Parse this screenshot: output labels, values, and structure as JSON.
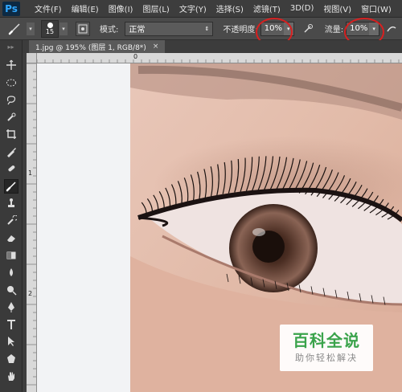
{
  "app": {
    "logo": "Ps"
  },
  "menu": [
    "文件(F)",
    "编辑(E)",
    "图像(I)",
    "图层(L)",
    "文字(Y)",
    "选择(S)",
    "滤镜(T)",
    "3D(D)",
    "视图(V)",
    "窗口(W)"
  ],
  "options": {
    "brush_size": "15",
    "mode_label": "模式:",
    "mode_value": "正常",
    "opacity_label": "不透明度:",
    "opacity_value": "10%",
    "flow_label": "流量:",
    "flow_value": "10%"
  },
  "document": {
    "tab_title": "1.jpg @ 195% (图层 1, RGB/8*)",
    "close": "×"
  },
  "rulers": {
    "top_zero": "0",
    "left_marks": [
      "1",
      "2"
    ]
  },
  "watermark": {
    "title": "百科全说",
    "subtitle": "助你轻松解决"
  },
  "colors": {
    "menubar": "#3d3d3d",
    "optbar": "#4a4a4a",
    "toolbox": "#3a3a3a",
    "highlight_ring": "#d62020",
    "watermark_green": "#3aa34b"
  },
  "tools": [
    "move-tool",
    "marquee-tool",
    "lasso-tool",
    "quick-select-tool",
    "crop-tool",
    "eyedropper-tool",
    "healing-brush-tool",
    "brush-tool",
    "clone-stamp-tool",
    "history-brush-tool",
    "eraser-tool",
    "gradient-tool",
    "blur-tool",
    "dodge-tool",
    "pen-tool",
    "type-tool",
    "path-select-tool",
    "shape-tool",
    "hand-tool"
  ]
}
